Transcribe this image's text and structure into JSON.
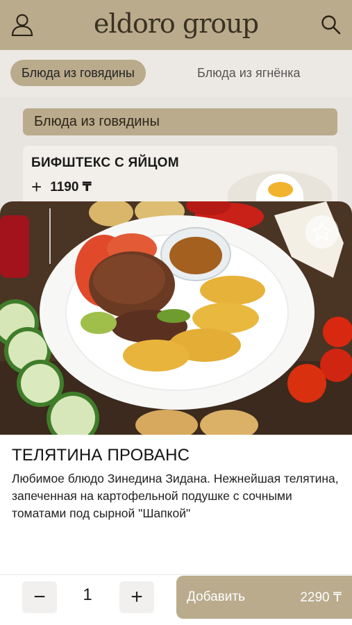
{
  "header": {
    "logo": "eldoro group",
    "icons": {
      "profile": "user-icon",
      "search": "search-icon"
    }
  },
  "tabs": [
    {
      "label": "Блюда из говядины",
      "active": true
    },
    {
      "label": "Блюда из ягнёнка",
      "active": false
    }
  ],
  "section": {
    "title": "Блюда из говядины"
  },
  "menu_item": {
    "title": "БИФШТЕКС С ЯЙЦОМ",
    "add_symbol": "+",
    "price": "1190 ₸"
  },
  "dish": {
    "title": "ТЕЛЯТИНА ПРОВАНС",
    "description": "Любимое блюдо Зинедина Зидана. Нежнейшая телятина, запеченная на картофельной подушке с сочными томатами под сырной \"Шапкой\"",
    "favorite_icon": "star-icon"
  },
  "order": {
    "minus": "−",
    "quantity": "1",
    "plus": "+",
    "add_label": "Добавить",
    "add_price": "2290 ₸"
  },
  "colors": {
    "accent": "#b9ab8c",
    "text": "#1a1a1a"
  }
}
